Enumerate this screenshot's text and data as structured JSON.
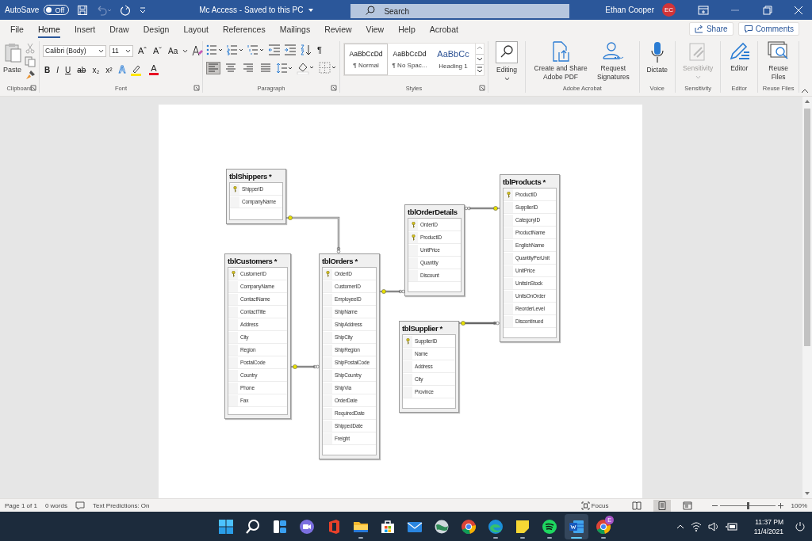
{
  "title_bar": {
    "autosave": {
      "label": "AutoSave",
      "state": "Off",
      "on": false
    },
    "document_title": "Mc Access  -  Saved to this PC",
    "search": {
      "placeholder": "Search"
    },
    "user": {
      "name": "Ethan Cooper",
      "initials": "EC"
    }
  },
  "ribbon_tabs": [
    {
      "label": "File",
      "selected": false
    },
    {
      "label": "Home",
      "selected": true
    },
    {
      "label": "Insert",
      "selected": false
    },
    {
      "label": "Draw",
      "selected": false
    },
    {
      "label": "Design",
      "selected": false
    },
    {
      "label": "Layout",
      "selected": false
    },
    {
      "label": "References",
      "selected": false
    },
    {
      "label": "Mailings",
      "selected": false
    },
    {
      "label": "Review",
      "selected": false
    },
    {
      "label": "View",
      "selected": false
    },
    {
      "label": "Help",
      "selected": false
    },
    {
      "label": "Acrobat",
      "selected": false
    }
  ],
  "share_button": "Share",
  "comments_button": "Comments",
  "clipboard": {
    "paste": "Paste",
    "label": "Clipboard"
  },
  "font": {
    "name": "Calibri (Body)",
    "size": "11",
    "size_buttons": [
      "Aˆ",
      "Aˇ"
    ],
    "case_button": "Aa",
    "format_buttons": [
      "B",
      "I",
      "U",
      "ab",
      "x₂",
      "x²"
    ],
    "effects_button": "A",
    "color_button": "A",
    "label": "Font"
  },
  "paragraph": {
    "pilcrow": "¶",
    "alignments": [
      {
        "kind": "left",
        "selected": true
      },
      {
        "kind": "center",
        "selected": false
      },
      {
        "kind": "right",
        "selected": false
      },
      {
        "kind": "justify",
        "selected": false
      }
    ],
    "label": "Paragraph"
  },
  "styles": {
    "items": [
      {
        "sample": "AaBbCcDd",
        "name": "¶ Normal",
        "kind": "body",
        "selected": true
      },
      {
        "sample": "AaBbCcDd",
        "name": "¶ No Spac...",
        "kind": "body",
        "selected": false
      },
      {
        "sample": "AaBbCc",
        "name": "Heading 1",
        "kind": "heading",
        "selected": false
      }
    ],
    "label": "Styles"
  },
  "command_groups": [
    {
      "buttons": [
        {
          "label": "Editing",
          "kind": "find",
          "disabled": false,
          "dropdown": true
        }
      ]
    },
    {
      "label": "Adobe Acrobat",
      "buttons": [
        {
          "label": "Create and Share Adobe PDF",
          "kind": "pdf",
          "disabled": false,
          "dropdown": false
        },
        {
          "label": "Request Signatures",
          "kind": "signature",
          "disabled": false,
          "dropdown": false
        }
      ]
    },
    {
      "label": "Voice",
      "buttons": [
        {
          "label": "Dictate",
          "kind": "mic",
          "disabled": false,
          "dropdown": false
        }
      ]
    },
    {
      "label": "Sensitivity",
      "buttons": [
        {
          "label": "Sensitivity",
          "kind": "sensitivity",
          "disabled": true,
          "dropdown": true
        }
      ]
    },
    {
      "label": "Editor",
      "buttons": [
        {
          "label": "Editor",
          "kind": "editor",
          "disabled": false,
          "dropdown": false
        }
      ]
    },
    {
      "label": "Reuse Files",
      "buttons": [
        {
          "label": "Reuse Files",
          "kind": "reuse",
          "disabled": false,
          "dropdown": false
        }
      ]
    }
  ],
  "diagram": {
    "tables": [
      {
        "title": "tblShippers *",
        "fields": [
          {
            "name": "ShipperID",
            "key": true
          },
          {
            "name": "CompanyName",
            "key": false
          }
        ]
      },
      {
        "title": "tblProducts *",
        "fields": [
          {
            "name": "ProductID",
            "key": true
          },
          {
            "name": "SupplierID",
            "key": false
          },
          {
            "name": "CategoryID",
            "key": false
          },
          {
            "name": "ProductName",
            "key": false
          },
          {
            "name": "EnglishName",
            "key": false
          },
          {
            "name": "QuantityPerUnit",
            "key": false
          },
          {
            "name": "UnitPrice",
            "key": false
          },
          {
            "name": "UnitsInStock",
            "key": false
          },
          {
            "name": "UnitsOnOrder",
            "key": false
          },
          {
            "name": "ReorderLevel",
            "key": false
          },
          {
            "name": "Discontinued",
            "key": false
          }
        ]
      },
      {
        "title": "tblOrderDetails",
        "fields": [
          {
            "name": "OrderID",
            "key": true
          },
          {
            "name": "ProductID",
            "key": true
          },
          {
            "name": "UnitPrice",
            "key": false
          },
          {
            "name": "Quantity",
            "key": false
          },
          {
            "name": "Discount",
            "key": false
          }
        ]
      },
      {
        "title": "tblCustomers *",
        "fields": [
          {
            "name": "CustomerID",
            "key": true
          },
          {
            "name": "CompanyName",
            "key": false
          },
          {
            "name": "ContactName",
            "key": false
          },
          {
            "name": "ContactTitle",
            "key": false
          },
          {
            "name": "Address",
            "key": false
          },
          {
            "name": "City",
            "key": false
          },
          {
            "name": "Region",
            "key": false
          },
          {
            "name": "PostalCode",
            "key": false
          },
          {
            "name": "Country",
            "key": false
          },
          {
            "name": "Phone",
            "key": false
          },
          {
            "name": "Fax",
            "key": false
          }
        ]
      },
      {
        "title": "tblOrders *",
        "fields": [
          {
            "name": "OrderID",
            "key": true
          },
          {
            "name": "CustomerID",
            "key": false
          },
          {
            "name": "EmployeeID",
            "key": false
          },
          {
            "name": "ShipName",
            "key": false
          },
          {
            "name": "ShipAddress",
            "key": false
          },
          {
            "name": "ShipCity",
            "key": false
          },
          {
            "name": "ShipRegion",
            "key": false
          },
          {
            "name": "ShipPostalCode",
            "key": false
          },
          {
            "name": "ShipCountry",
            "key": false
          },
          {
            "name": "ShipVia",
            "key": false
          },
          {
            "name": "OrderDate",
            "key": false
          },
          {
            "name": "RequiredDate",
            "key": false
          },
          {
            "name": "ShippedDate",
            "key": false
          },
          {
            "name": "Freight",
            "key": false
          }
        ]
      },
      {
        "title": "tblSupplier *",
        "fields": [
          {
            "name": "SupplierID",
            "key": true
          },
          {
            "name": "Name",
            "key": false
          },
          {
            "name": "Address",
            "key": false
          },
          {
            "name": "City",
            "key": false
          },
          {
            "name": "Province",
            "key": false
          }
        ]
      }
    ]
  },
  "status_bar": {
    "page": "Page 1 of 1",
    "words": "0 words",
    "text_predictions": "Text Predictions: On",
    "focus": "Focus",
    "views": [
      {
        "kind": "read",
        "selected": false
      },
      {
        "kind": "print",
        "selected": true
      },
      {
        "kind": "web",
        "selected": false
      }
    ],
    "zoom": {
      "level": 0.5,
      "reading": "100%"
    }
  },
  "taskbar": {
    "apps": [
      {
        "kind": "start",
        "running": false,
        "selected": false
      },
      {
        "kind": "search",
        "running": false,
        "selected": false
      },
      {
        "kind": "widgets",
        "running": false,
        "selected": false
      },
      {
        "kind": "chat",
        "running": false,
        "selected": false
      },
      {
        "kind": "office",
        "running": false,
        "selected": false
      },
      {
        "kind": "explorer",
        "running": true,
        "selected": false
      },
      {
        "kind": "store",
        "running": false,
        "selected": false
      },
      {
        "kind": "mail",
        "running": false,
        "selected": false
      },
      {
        "kind": "globe",
        "running": false,
        "selected": false
      },
      {
        "kind": "chrome",
        "running": false,
        "selected": false
      },
      {
        "kind": "edge",
        "running": true,
        "selected": false
      },
      {
        "kind": "notes",
        "running": true,
        "selected": false
      },
      {
        "kind": "spotify",
        "running": true,
        "selected": false
      },
      {
        "kind": "word",
        "running": true,
        "selected": true
      },
      {
        "kind": "profile",
        "running": true,
        "selected": false,
        "badge": "E"
      }
    ],
    "clock": {
      "time": "11:37 PM",
      "date": "11/4/2021"
    }
  }
}
